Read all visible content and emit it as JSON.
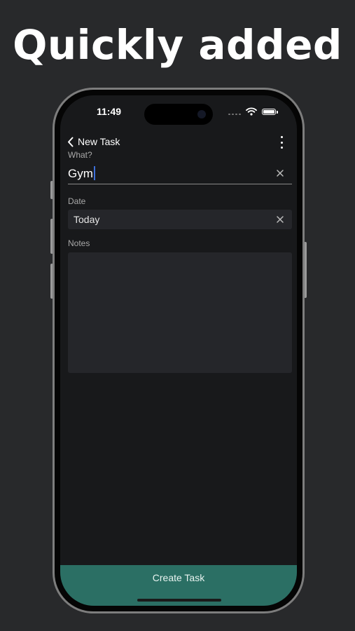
{
  "promo": {
    "headline": "Quickly added"
  },
  "status_bar": {
    "time": "11:49"
  },
  "nav": {
    "back_label": "New Task"
  },
  "form": {
    "what_label": "What?",
    "what_value": "Gym",
    "date_label": "Date",
    "date_value": "Today",
    "notes_label": "Notes",
    "notes_value": ""
  },
  "actions": {
    "create_label": "Create Task"
  },
  "colors": {
    "background": "#28292b",
    "screen": "#18191b",
    "accent": "#2b6f64",
    "caret": "#3d6fd9"
  }
}
